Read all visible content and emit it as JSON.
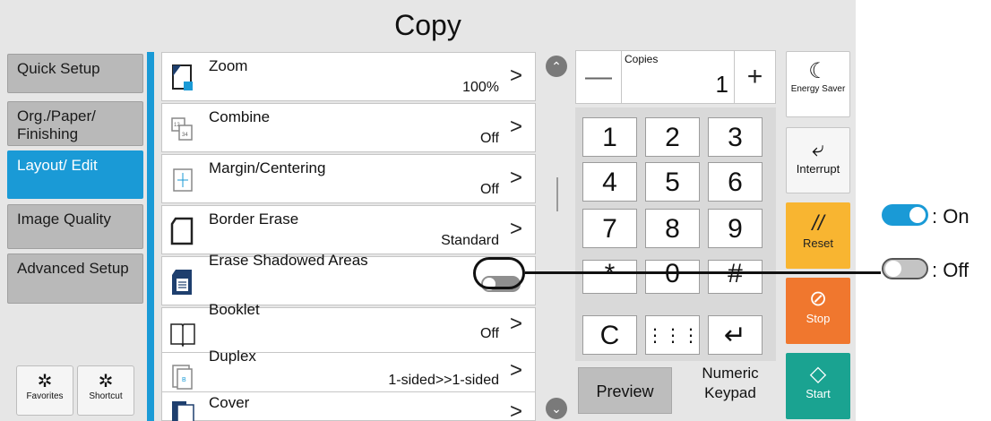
{
  "screen": {
    "title": "Copy"
  },
  "tabs": [
    {
      "label": "Quick Setup",
      "active": false
    },
    {
      "label": "Org./Paper/ Finishing",
      "active": false
    },
    {
      "label": "Layout/ Edit",
      "active": true
    },
    {
      "label": "Image Quality",
      "active": false
    },
    {
      "label": "Advanced Setup",
      "active": false
    }
  ],
  "bottom_buttons": {
    "favorites": "Favorites",
    "shortcut": "Shortcut"
  },
  "functions": [
    {
      "label": "Zoom",
      "value": "100%",
      "icon": "zoom-icon"
    },
    {
      "label": "Combine",
      "value": "Off",
      "icon": "combine-icon"
    },
    {
      "label": "Margin/Centering",
      "value": "Off",
      "icon": "margin-icon"
    },
    {
      "label": "Border Erase",
      "value": "Standard",
      "icon": "border-erase-icon"
    },
    {
      "label": "Erase Shadowed Areas",
      "value": "",
      "icon": "erase-shadow-icon",
      "toggle": "off"
    },
    {
      "label": "Booklet",
      "value": "Off",
      "icon": "booklet-icon"
    },
    {
      "label": "Duplex",
      "value": "1-sided>>1-sided",
      "icon": "duplex-icon"
    },
    {
      "label": "Cover",
      "value": "",
      "icon": "cover-icon"
    }
  ],
  "copies": {
    "label": "Copies",
    "value": "1",
    "minus": "—",
    "plus": "+"
  },
  "keypad": {
    "keys": [
      "1",
      "2",
      "3",
      "4",
      "5",
      "6",
      "7",
      "8",
      "9",
      "*",
      "0",
      "#",
      "C",
      "⋮⋮⋮",
      "↵"
    ],
    "preview": "Preview",
    "numeric_keypad": "Numeric Keypad"
  },
  "right_buttons": {
    "energy_saver": "Energy Saver",
    "interrupt": "Interrupt",
    "reset": "Reset",
    "stop": "Stop",
    "start": "Start"
  },
  "legend": {
    "on": ": On",
    "off": ": Off"
  },
  "colors": {
    "accent": "#1a9ad6",
    "reset": "#f8b531",
    "stop": "#f0772e",
    "start": "#1aa391"
  }
}
